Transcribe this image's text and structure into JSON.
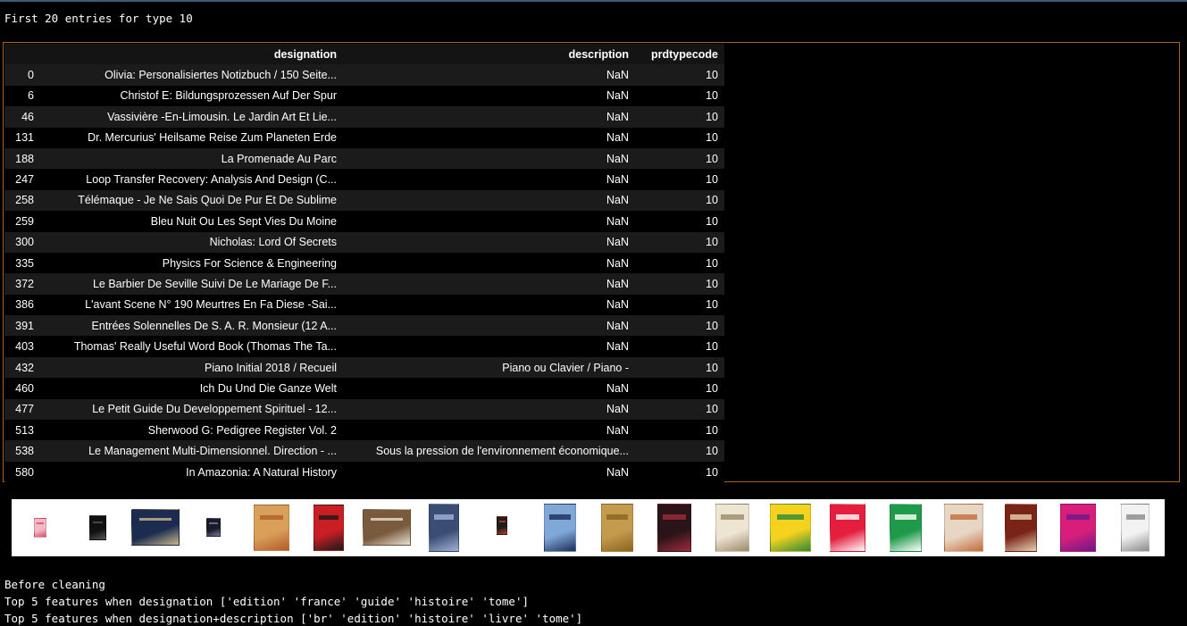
{
  "heading": "First 20 entries for type 10",
  "table": {
    "columns": [
      "",
      "designation",
      "description",
      "prdtypecode"
    ],
    "rows": [
      {
        "index": "0",
        "designation": "Olivia: Personalisiertes Notizbuch / 150 Seite...",
        "description": "NaN",
        "prdtypecode": "10"
      },
      {
        "index": "6",
        "designation": "Christof E: Bildungsprozessen Auf Der Spur",
        "description": "NaN",
        "prdtypecode": "10"
      },
      {
        "index": "46",
        "designation": "Vassivière -En-Limousin. Le Jardin Art Et Lie...",
        "description": "NaN",
        "prdtypecode": "10"
      },
      {
        "index": "131",
        "designation": "Dr. Mercurius' Heilsame Reise Zum Planeten Erde",
        "description": "NaN",
        "prdtypecode": "10"
      },
      {
        "index": "188",
        "designation": "La Promenade Au Parc",
        "description": "NaN",
        "prdtypecode": "10"
      },
      {
        "index": "247",
        "designation": "Loop Transfer Recovery: Analysis And Design (C...",
        "description": "NaN",
        "prdtypecode": "10"
      },
      {
        "index": "258",
        "designation": "Télémaque - Je Ne Sais Quoi De Pur Et De Sublime",
        "description": "NaN",
        "prdtypecode": "10"
      },
      {
        "index": "259",
        "designation": "Bleu Nuit Ou Les Sept Vies Du Moine",
        "description": "NaN",
        "prdtypecode": "10"
      },
      {
        "index": "300",
        "designation": "Nicholas: Lord Of Secrets",
        "description": "NaN",
        "prdtypecode": "10"
      },
      {
        "index": "335",
        "designation": "Physics For Science & Engineering",
        "description": "NaN",
        "prdtypecode": "10"
      },
      {
        "index": "372",
        "designation": "Le Barbier De Seville Suivi De Le Mariage De F...",
        "description": "NaN",
        "prdtypecode": "10"
      },
      {
        "index": "386",
        "designation": "L'avant Scene N° 190 Meurtres En Fa Diese -Sai...",
        "description": "NaN",
        "prdtypecode": "10"
      },
      {
        "index": "391",
        "designation": "Entrées Solennelles De S. A. R. Monsieur (12 A...",
        "description": "NaN",
        "prdtypecode": "10"
      },
      {
        "index": "403",
        "designation": "Thomas' Really Useful Word Book (Thomas The Ta...",
        "description": "NaN",
        "prdtypecode": "10"
      },
      {
        "index": "432",
        "designation": "Piano Initial 2018 / Recueil",
        "description": "Piano ou Clavier / Piano -",
        "prdtypecode": "10"
      },
      {
        "index": "460",
        "designation": "Ich Du Und Die Ganze Welt",
        "description": "NaN",
        "prdtypecode": "10"
      },
      {
        "index": "477",
        "designation": "Le Petit Guide Du Developpement Spirituel - 12...",
        "description": "NaN",
        "prdtypecode": "10"
      },
      {
        "index": "513",
        "designation": "Sherwood G: Pedigree Register Vol. 2",
        "description": "NaN",
        "prdtypecode": "10"
      },
      {
        "index": "538",
        "designation": "Le Management Multi-Dimensionnel. Direction - ...",
        "description": "Sous la pression de l'environnement économique...",
        "prdtypecode": "10"
      },
      {
        "index": "580",
        "designation": "In Amazonia: A Natural History",
        "description": "NaN",
        "prdtypecode": "10"
      }
    ]
  },
  "thumbnails": [
    {
      "name": "cover-0",
      "color": "#f2b8c6",
      "accent": "#e04a6a"
    },
    {
      "name": "cover-6",
      "color": "#111111",
      "accent": "#555555"
    },
    {
      "name": "cover-46",
      "color": "#1c2c50",
      "accent": "#c9b88a"
    },
    {
      "name": "cover-131",
      "color": "#1a1a2a",
      "accent": "#6f7fa0"
    },
    {
      "name": "cover-188",
      "color": "#d9a05a",
      "accent": "#b45a2a"
    },
    {
      "name": "cover-247",
      "color": "#c81e24",
      "accent": "#1a1a1a"
    },
    {
      "name": "cover-258",
      "color": "#7a5a3c",
      "accent": "#e9e2d3"
    },
    {
      "name": "cover-259",
      "color": "#3b4d73",
      "accent": "#9fb2d6"
    },
    {
      "name": "cover-300",
      "color": "#1e1e1e",
      "accent": "#c0392b"
    },
    {
      "name": "cover-335",
      "color": "#7fa7d8",
      "accent": "#1b2e57"
    },
    {
      "name": "cover-372",
      "color": "#c49a4c",
      "accent": "#8a6420"
    },
    {
      "name": "cover-386",
      "color": "#2a1418",
      "accent": "#a02a3a"
    },
    {
      "name": "cover-391",
      "color": "#eee4d2",
      "accent": "#9b8a6a"
    },
    {
      "name": "cover-403",
      "color": "#f5d21e",
      "accent": "#2a8a3a"
    },
    {
      "name": "cover-432",
      "color": "#e41e3c",
      "accent": "#ffffff"
    },
    {
      "name": "cover-460",
      "color": "#1e9a4a",
      "accent": "#ffffff"
    },
    {
      "name": "cover-477",
      "color": "#e8d6c4",
      "accent": "#c46a3a"
    },
    {
      "name": "cover-513",
      "color": "#7a2418",
      "accent": "#e6d2b0"
    },
    {
      "name": "cover-538",
      "color": "#d81e7a",
      "accent": "#6a1a8a"
    },
    {
      "name": "cover-580",
      "color": "#f2f2f2",
      "accent": "#8a8a8a"
    }
  ],
  "footer": {
    "line1": "Before cleaning",
    "line2": "Top 5 features when designation ['edition' 'france' 'guide' 'histoire' 'tome']",
    "line3": "Top 5 features when designation+description ['br' 'edition' 'histoire' 'livre' 'tome']"
  }
}
